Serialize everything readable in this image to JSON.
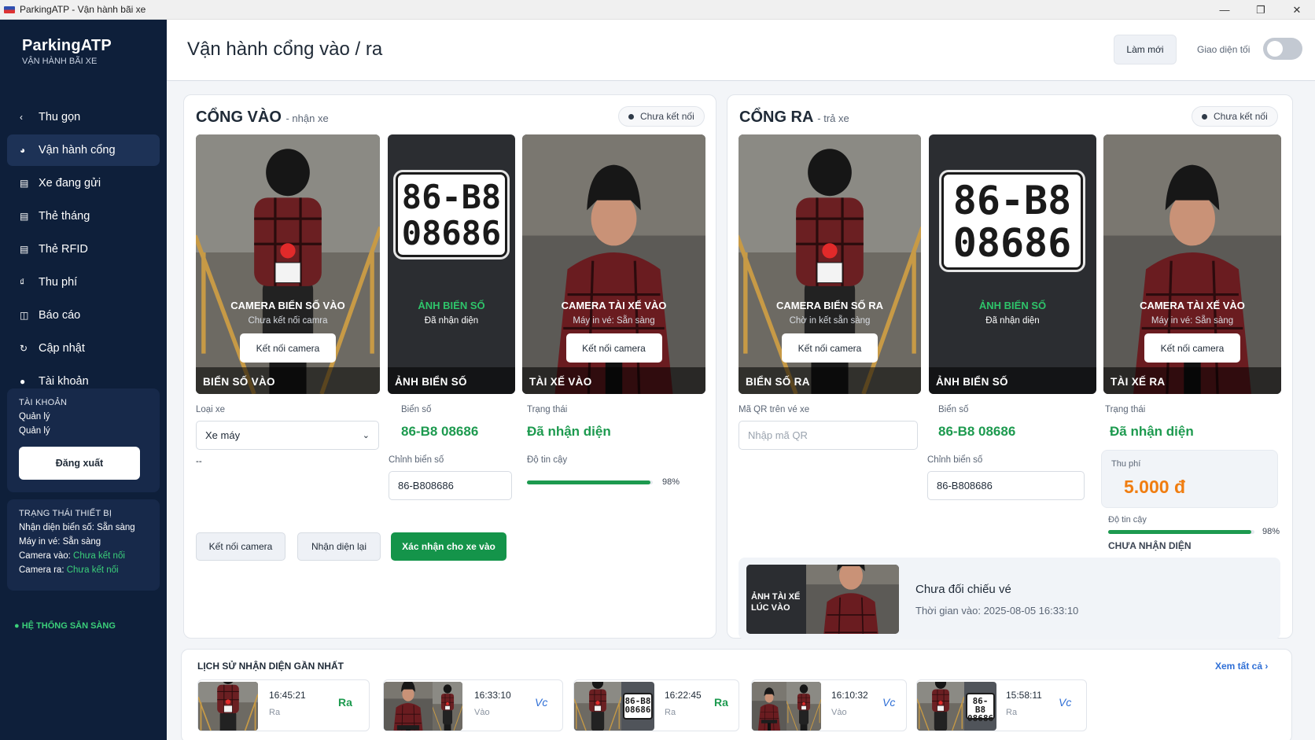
{
  "window": {
    "title": "ParkingATP - Vận hành bãi xe",
    "controls": [
      "—",
      "❐",
      "✕"
    ]
  },
  "brand": {
    "name": "ParkingATP",
    "subtitle": "VẬN HÀNH BÃI XE"
  },
  "nav": [
    {
      "icon": "chevron-left-icon",
      "glyph": "‹",
      "label": "Thu gọn"
    },
    {
      "icon": "gate-icon",
      "glyph": "◕",
      "label": "Vận hành cổng"
    },
    {
      "icon": "vehicle-list-icon",
      "glyph": "▤",
      "label": "Xe đang gửi"
    },
    {
      "icon": "monthly-card-icon",
      "glyph": "▤",
      "label": "Thẻ tháng"
    },
    {
      "icon": "rfid-card-icon",
      "glyph": "▤",
      "label": "Thẻ RFID"
    },
    {
      "icon": "fee-icon",
      "glyph": "₫",
      "label": "Thu phí"
    },
    {
      "icon": "report-icon",
      "glyph": "◫",
      "label": "Báo cáo"
    },
    {
      "icon": "update-icon",
      "glyph": "↻",
      "label": "Cập nhật"
    },
    {
      "icon": "user-icon",
      "glyph": "●",
      "label": "Tài khoản"
    }
  ],
  "account": {
    "heading": "TÀI KHOẢN",
    "name": "Quản lý",
    "role": "Quản lý",
    "logout_label": "Đăng xuất"
  },
  "devices": {
    "heading": "TRẠNG THÁI THIẾT BỊ",
    "plate_recog": "Nhận diện biển số: Sẵn sàng",
    "ticket_printer": "Máy in vé: Sẵn sàng",
    "camera_in": "Camera vào: Chưa kết nối",
    "camera_out": "Camera ra: Chưa kết nối"
  },
  "system_status": "● HỆ THỐNG SẴN SÀNG",
  "header": {
    "title": "Vận hành cổng vào / ra",
    "refresh_label": "Làm mới",
    "dark_mode_label": "Giao diện tối",
    "dark_mode_on": false
  },
  "gate_in": {
    "title": "CỔNG VÀO",
    "subtitle": "- nhận xe",
    "status": "Chưa kết nối",
    "cameras": [
      {
        "title": "CAMERA BIỂN SỐ VÀO",
        "subtitle": "Chưa kết nối camra",
        "button": "Kết nối camera",
        "label": "BIỂN SỐ VÀO"
      },
      {
        "title": "ẢNH BIỂN SỐ",
        "subtitle": "Đã nhận diện",
        "label": "ẢNH BIỂN SỐ"
      },
      {
        "title": "CAMERA TÀI XẾ VÀO",
        "subtitle": "Máy in vé: Sẵn sàng",
        "button": "Kết nối camera",
        "label": "TÀI XẾ VÀO"
      }
    ],
    "vehicle_type_label": "Loại xe",
    "vehicle_type_value": "Xe máy",
    "vehicle_type_note": "--",
    "plate_label": "Biển số",
    "plate_value": "86-B8 08686",
    "status_label": "Trạng thái",
    "status_value": "Đã nhận diện",
    "plate_edit_label": "Chỉnh biển số",
    "plate_edit_value": "86-B808686",
    "confidence_label": "Độ tin cậy",
    "confidence": 0.98,
    "confidence_text": "98%",
    "btn_connect": "Kết nối camera",
    "btn_rerecog": "Nhận diện lại",
    "btn_confirm": "Xác nhận cho xe vào"
  },
  "gate_out": {
    "title": "CỔNG RA",
    "subtitle": "- trả xe",
    "status": "Chưa kết nối",
    "cameras": [
      {
        "title": "CAMERA BIỂN SỐ RA",
        "subtitle": "Chờ in kết sẵn sàng",
        "button": "Kết nối camera",
        "label": "BIỂN SỐ RA"
      },
      {
        "title": "ẢNH BIỂN SỐ",
        "subtitle": "Đã nhận diện",
        "label": "ẢNH BIỂN SỐ"
      },
      {
        "title": "CAMERA TÀI XẾ VÀO",
        "subtitle": "Máy in vé: Sẵn sàng",
        "button": "Kết nối camera",
        "label": "TÀI XẾ RA"
      }
    ],
    "qr_label": "Mã QR trên vé xe",
    "qr_placeholder": "Nhập mã QR",
    "plate_label": "Biển số",
    "plate_value": "86-B8 08686",
    "status_label": "Trạng thái",
    "status_value": "Đã nhận diện",
    "plate_edit_label": "Chỉnh biển số",
    "plate_edit_value": "86-B808686",
    "fee_label": "Thu phí",
    "fee_value": "5.000 đ",
    "confidence_label": "Độ tin cậy",
    "confidence": 0.98,
    "confidence_text": "98%",
    "recog_state": "CHƯA NHẬN DIỆN",
    "entry_photo_label": "ẢNH TÀI XẾ LÚC VÀO",
    "ticket_state": "Chưa đối chiếu vé",
    "entry_time": "Thời gian vào: 2025-08-05 16:33:10"
  },
  "plate_image": {
    "line1": "86-B8",
    "line2": "08686"
  },
  "history": {
    "title": "LỊCH SỬ NHẬN DIỆN GẦN NHẤT",
    "view_all": "Xem tất cả ›",
    "items": [
      {
        "time": "16:45:21",
        "direction": "Ra",
        "tag": "Ra"
      },
      {
        "time": "16:33:10",
        "direction": "Vào",
        "tag": "Vc"
      },
      {
        "time": "16:22:45",
        "direction": "Ra",
        "tag": "Ra"
      },
      {
        "time": "16:10:32",
        "direction": "Vào",
        "tag": "Vc"
      },
      {
        "time": "15:58:11",
        "direction": "Ra",
        "tag": "Vc"
      }
    ]
  },
  "colors": {
    "sidebar": "#0e1f3a",
    "accent_green": "#14944a",
    "text_green": "#1d9a4f",
    "fee_orange": "#f07d10"
  }
}
